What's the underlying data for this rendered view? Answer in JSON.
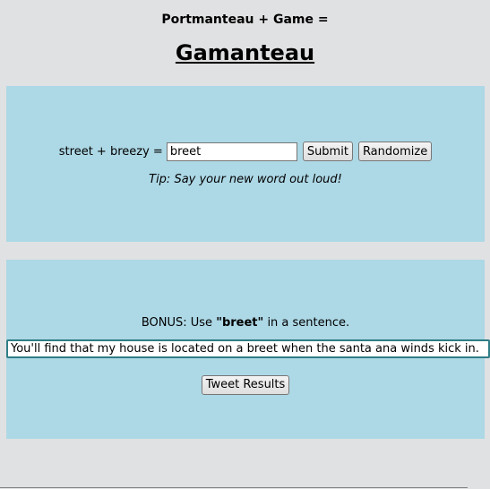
{
  "header": {
    "subtitle": "Portmanteau + Game =",
    "title": "Gamanteau"
  },
  "game": {
    "equation": "street + breezy =",
    "word_value": "breet",
    "submit_label": "Submit",
    "randomize_label": "Randomize",
    "tip": "Tip: Say your new word out loud!"
  },
  "bonus": {
    "prefix": "BONUS: Use ",
    "word": "\"breet\"",
    "suffix": " in a sentence.",
    "sentence_value": "You'll find that my house is located on a breet when the santa ana winds kick in.",
    "tweet_label": "Tweet Results"
  }
}
